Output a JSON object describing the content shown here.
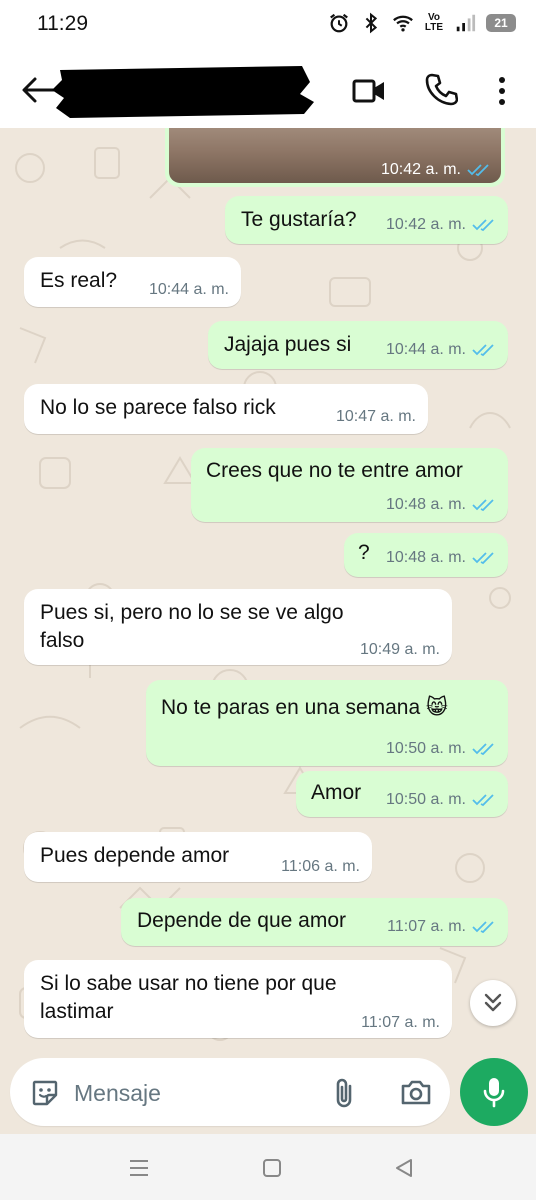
{
  "status_bar": {
    "time": "11:29",
    "icons": [
      "alarm-icon",
      "bluetooth-icon",
      "wifi-icon",
      "volte-icon",
      "signal-icon",
      "battery-icon"
    ],
    "network_label": "Vo\nLTE",
    "battery_level": "21"
  },
  "header": {
    "contact_name": "",
    "icons": [
      "back-arrow-icon",
      "video-call-icon",
      "phone-icon",
      "more-vert-icon"
    ]
  },
  "chat": {
    "messages": [
      {
        "type": "image",
        "direction": "outgoing",
        "time": "10:42 a. m.",
        "status": "read"
      },
      {
        "direction": "outgoing",
        "text": "Te gustaría?",
        "time": "10:42 a. m.",
        "status": "read"
      },
      {
        "direction": "incoming",
        "text": "Es real?",
        "time": "10:44 a. m."
      },
      {
        "direction": "outgoing",
        "text": "Jajaja pues si",
        "time": "10:44 a. m.",
        "status": "read"
      },
      {
        "direction": "incoming",
        "text": "No lo se parece falso rick",
        "time": "10:47 a. m."
      },
      {
        "direction": "outgoing",
        "text": "Crees que no te entre amor",
        "time": "10:48 a. m.",
        "status": "read"
      },
      {
        "direction": "outgoing",
        "text": "?",
        "time": "10:48 a. m.",
        "status": "read"
      },
      {
        "direction": "incoming",
        "text": "Pues si, pero no lo se se ve algo\nfalso",
        "time": "10:49 a. m."
      },
      {
        "direction": "outgoing",
        "text": "No te paras en una semana 😸",
        "time": "10:50 a. m.",
        "status": "read"
      },
      {
        "direction": "outgoing",
        "text": "Amor",
        "time": "10:50 a. m.",
        "status": "read"
      },
      {
        "direction": "incoming",
        "text": "Pues depende amor",
        "time": "11:06 a. m."
      },
      {
        "direction": "outgoing",
        "text": "Depende de que amor",
        "time": "11:07 a. m.",
        "status": "read"
      },
      {
        "direction": "incoming",
        "text": "Si lo sabe usar no tiene por que\nlastimar",
        "time": "11:07 a. m."
      }
    ],
    "read_tick_color": "#53bdeb",
    "scroll_down_icon": "double-chevron-down-icon"
  },
  "composer": {
    "placeholder": "Mensaje",
    "icons": [
      "sticker-icon",
      "paperclip-icon",
      "camera-icon",
      "mic-icon"
    ],
    "mic_color": "#1daa61"
  },
  "nav_bar": {
    "icons": [
      "recents-icon",
      "home-icon",
      "back-triangle-icon"
    ]
  },
  "colors": {
    "outgoing_bubble": "#d9fdd3",
    "incoming_bubble": "#ffffff",
    "chat_background": "#efe7dc",
    "timestamp": "#667781"
  }
}
